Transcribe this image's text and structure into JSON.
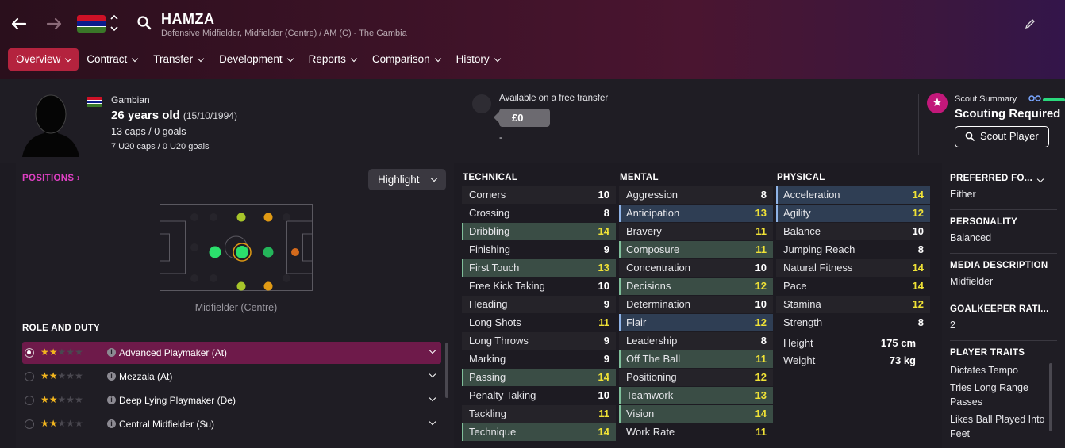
{
  "header": {
    "player_name": "HAMZA",
    "positions_line": "Defensive Midfielder, Midfielder (Centre) / AM (C) - The Gambia",
    "flag_colors": [
      "#ce1126",
      "#ffffff",
      "#0c1c8c",
      "#ffffff",
      "#3a7728"
    ],
    "icons": [
      "back-arrow-icon",
      "forward-arrow-icon",
      "search-icon",
      "pencil-icon"
    ]
  },
  "tabs": [
    {
      "label": "Overview",
      "active": true
    },
    {
      "label": "Contract"
    },
    {
      "label": "Transfer"
    },
    {
      "label": "Development"
    },
    {
      "label": "Reports"
    },
    {
      "label": "Comparison"
    },
    {
      "label": "History"
    }
  ],
  "bio": {
    "nationality": "Gambian",
    "age": "26 years old",
    "dob": "(15/10/1994)",
    "caps": "13 caps / 0 goals",
    "u20_caps": "7 U20 caps / 0 U20 goals"
  },
  "transfer": {
    "status": "Available on a free transfer",
    "value": "£0",
    "note": "-"
  },
  "scout": {
    "label": "Scout Summary",
    "status": "Scouting Required",
    "button": "Scout Player"
  },
  "positions": {
    "title": "POSITIONS",
    "highlight_label": "Highlight",
    "caption": "Midfielder (Centre)"
  },
  "roles": {
    "title": "ROLE AND DUTY",
    "items": [
      {
        "name": "Advanced Playmaker (At)",
        "stars": 2,
        "selected": true
      },
      {
        "name": "Mezzala (At)",
        "stars": 2
      },
      {
        "name": "Deep Lying Playmaker (De)",
        "stars": 2
      },
      {
        "name": "Central Midfielder (Su)",
        "stars": 2
      }
    ]
  },
  "technical": {
    "title": "TECHNICAL",
    "rows": [
      {
        "name": "Corners",
        "value": "10"
      },
      {
        "name": "Crossing",
        "value": "8"
      },
      {
        "name": "Dribbling",
        "value": "14",
        "hl": "g"
      },
      {
        "name": "Finishing",
        "value": "9"
      },
      {
        "name": "First Touch",
        "value": "13",
        "hl": "g"
      },
      {
        "name": "Free Kick Taking",
        "value": "10"
      },
      {
        "name": "Heading",
        "value": "9"
      },
      {
        "name": "Long Shots",
        "value": "11"
      },
      {
        "name": "Long Throws",
        "value": "9"
      },
      {
        "name": "Marking",
        "value": "9"
      },
      {
        "name": "Passing",
        "value": "14",
        "hl": "g"
      },
      {
        "name": "Penalty Taking",
        "value": "10"
      },
      {
        "name": "Tackling",
        "value": "11"
      },
      {
        "name": "Technique",
        "value": "14",
        "hl": "g"
      }
    ]
  },
  "mental": {
    "title": "MENTAL",
    "rows": [
      {
        "name": "Aggression",
        "value": "8"
      },
      {
        "name": "Anticipation",
        "value": "13",
        "hl": "b"
      },
      {
        "name": "Bravery",
        "value": "11"
      },
      {
        "name": "Composure",
        "value": "11",
        "hl": "g"
      },
      {
        "name": "Concentration",
        "value": "10"
      },
      {
        "name": "Decisions",
        "value": "12",
        "hl": "g"
      },
      {
        "name": "Determination",
        "value": "10"
      },
      {
        "name": "Flair",
        "value": "12",
        "hl": "b"
      },
      {
        "name": "Leadership",
        "value": "8"
      },
      {
        "name": "Off The Ball",
        "value": "11",
        "hl": "g"
      },
      {
        "name": "Positioning",
        "value": "12"
      },
      {
        "name": "Teamwork",
        "value": "13",
        "hl": "g"
      },
      {
        "name": "Vision",
        "value": "14",
        "hl": "g"
      },
      {
        "name": "Work Rate",
        "value": "11"
      }
    ]
  },
  "physical": {
    "title": "PHYSICAL",
    "rows": [
      {
        "name": "Acceleration",
        "value": "14",
        "hl": "b"
      },
      {
        "name": "Agility",
        "value": "12",
        "hl": "b"
      },
      {
        "name": "Balance",
        "value": "10"
      },
      {
        "name": "Jumping Reach",
        "value": "8"
      },
      {
        "name": "Natural Fitness",
        "value": "14"
      },
      {
        "name": "Pace",
        "value": "14"
      },
      {
        "name": "Stamina",
        "value": "12"
      },
      {
        "name": "Strength",
        "value": "8"
      }
    ],
    "height_label": "Height",
    "height": "175 cm",
    "weight_label": "Weight",
    "weight": "73 kg"
  },
  "sidebar": {
    "preferred_foot_label": "PREFERRED FO...",
    "preferred_foot": "Either",
    "personality_label": "PERSONALITY",
    "personality": "Balanced",
    "media_label": "MEDIA DESCRIPTION",
    "media": "Midfielder",
    "gk_label": "GOALKEEPER RATI...",
    "gk": "2",
    "traits_label": "PLAYER TRAITS",
    "traits": [
      "Dictates Tempo",
      "Tries Long Range Passes",
      "Likes Ball Played Into Feet"
    ]
  }
}
